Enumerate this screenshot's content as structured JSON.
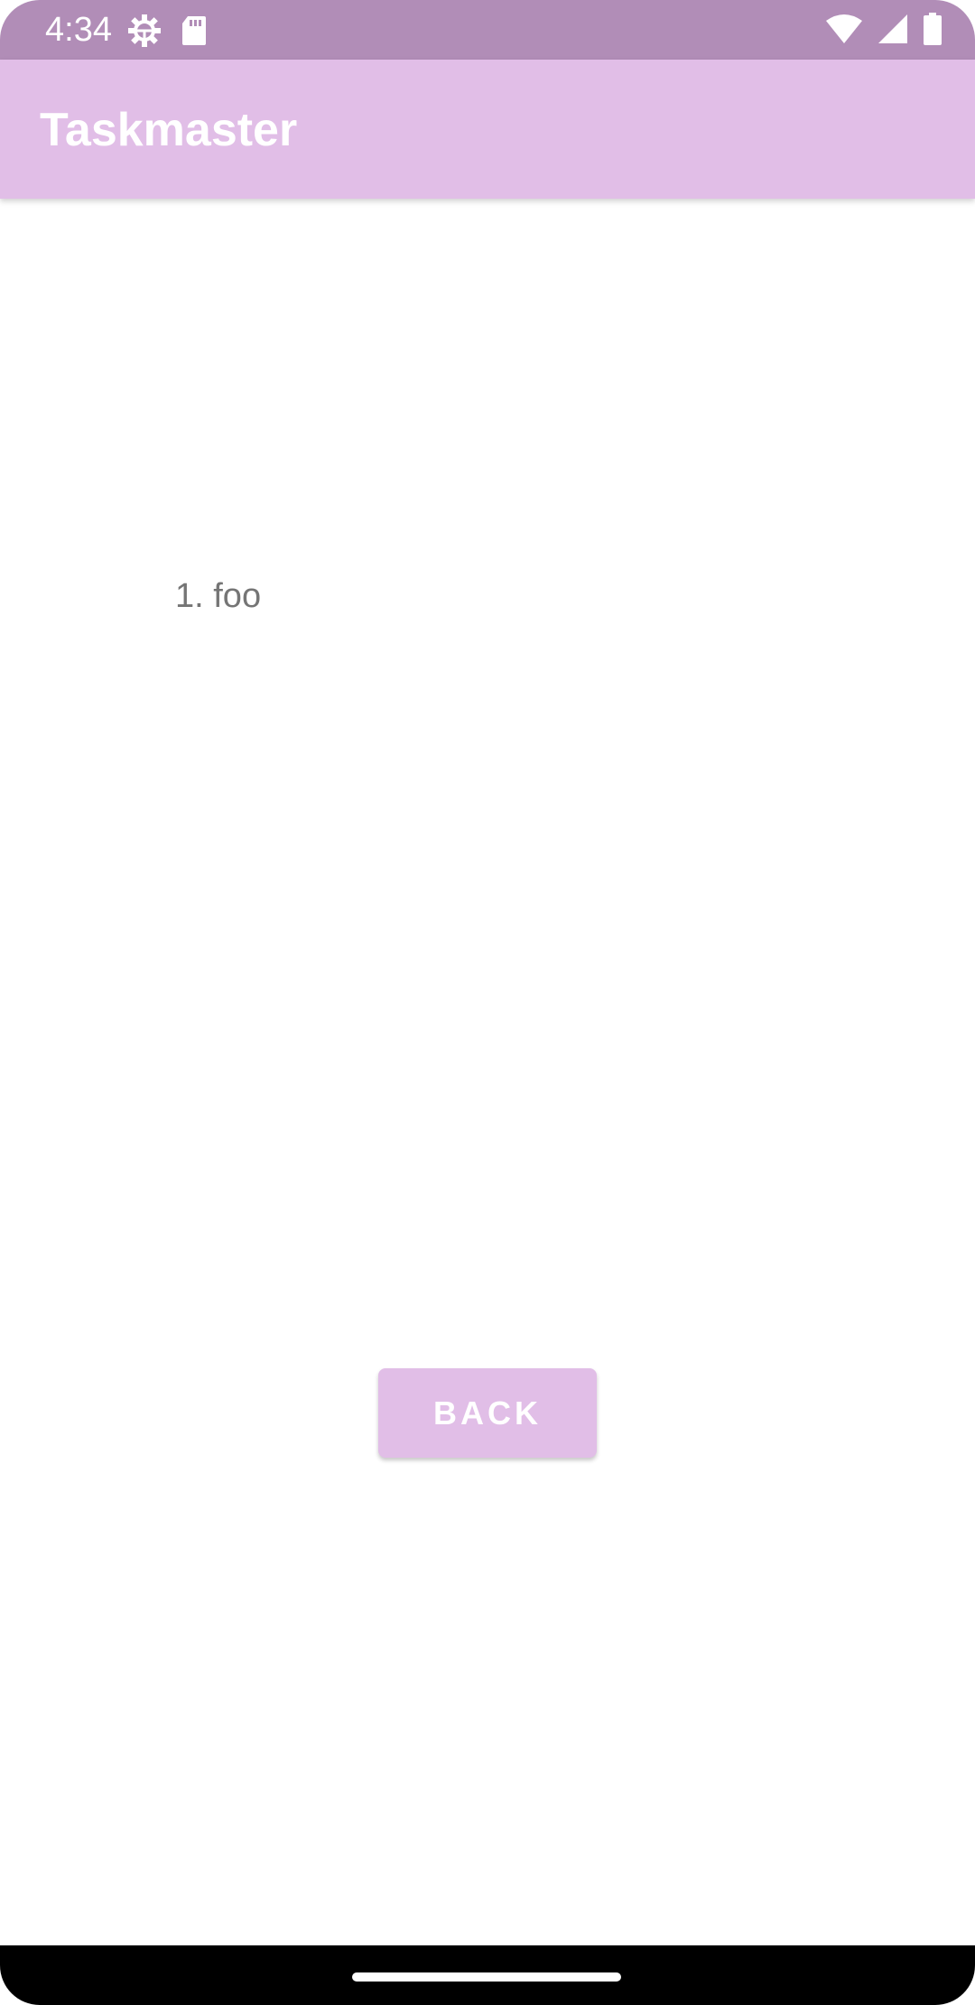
{
  "status_bar": {
    "time": "4:34",
    "left_icons": [
      "settings-gear-icon",
      "sd-card-icon"
    ],
    "right_icons": [
      "wifi-icon",
      "cellular-signal-icon",
      "battery-icon"
    ],
    "background_color": "#b18db7"
  },
  "app_bar": {
    "title": "Taskmaster",
    "background_color": "#e1bee7"
  },
  "content": {
    "task_items": [
      "1. foo"
    ]
  },
  "actions": {
    "back_label": "BACK"
  },
  "colors": {
    "accent": "#e1bee7",
    "text_secondary": "#757575"
  }
}
